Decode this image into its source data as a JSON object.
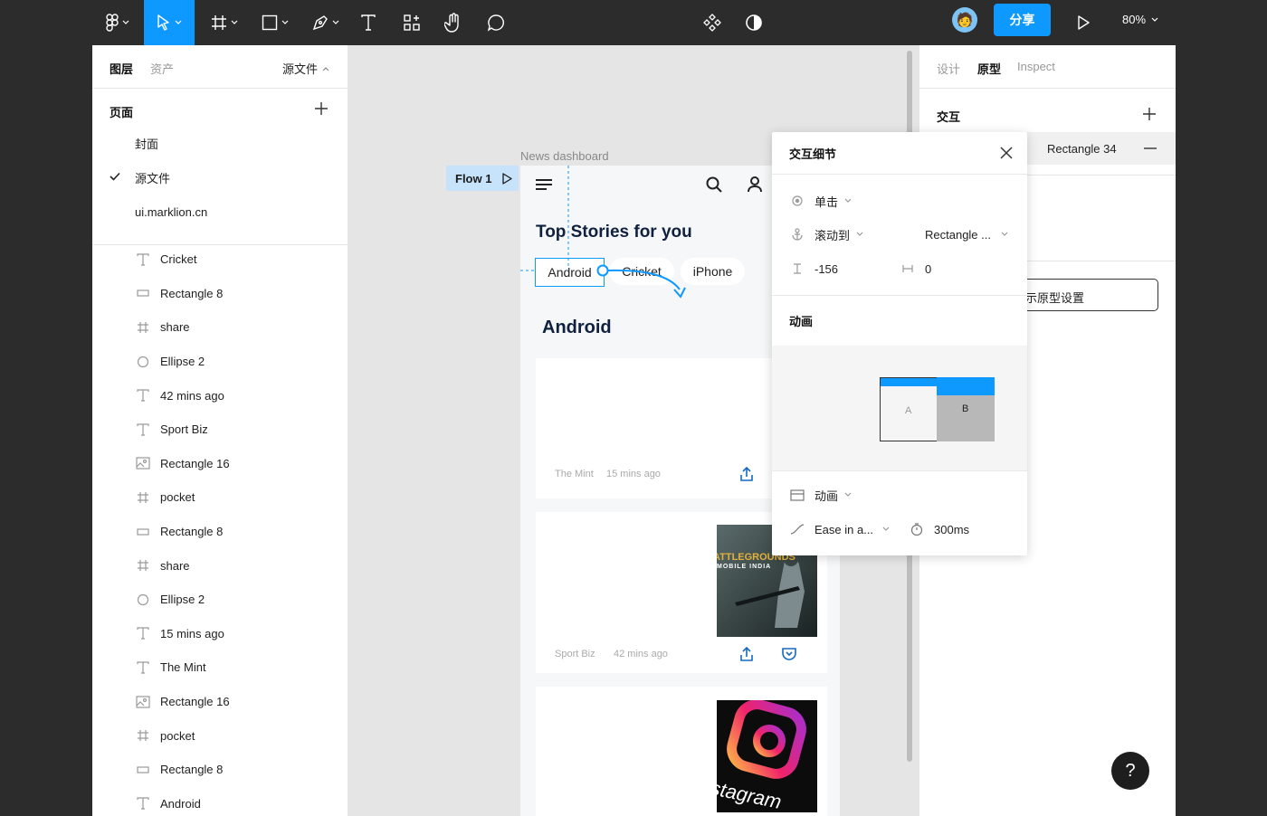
{
  "toolbar": {
    "share_label": "分享",
    "zoom_label": "80%"
  },
  "left_panel": {
    "tabs": {
      "layers": "图层",
      "assets": "资产"
    },
    "page_dropdown": "源文件",
    "pages_title": "页面",
    "pages": [
      {
        "label": "封面",
        "selected": false
      },
      {
        "label": "源文件",
        "selected": true
      },
      {
        "label": "ui.marklion.cn",
        "selected": false
      }
    ],
    "layers": [
      {
        "label": "Cricket",
        "icon": "text-icon"
      },
      {
        "label": "Rectangle 8",
        "icon": "rectangle-icon"
      },
      {
        "label": "share",
        "icon": "frame-icon"
      },
      {
        "label": "Ellipse 2",
        "icon": "ellipse-icon"
      },
      {
        "label": "42 mins ago",
        "icon": "text-icon"
      },
      {
        "label": "Sport Biz",
        "icon": "text-icon"
      },
      {
        "label": "Rectangle 16",
        "icon": "image-icon"
      },
      {
        "label": "pocket",
        "icon": "frame-icon"
      },
      {
        "label": "Rectangle 8",
        "icon": "rectangle-icon"
      },
      {
        "label": "share",
        "icon": "frame-icon"
      },
      {
        "label": "Ellipse 2",
        "icon": "ellipse-icon"
      },
      {
        "label": "15 mins ago",
        "icon": "text-icon"
      },
      {
        "label": "The Mint",
        "icon": "text-icon"
      },
      {
        "label": "Rectangle 16",
        "icon": "image-icon"
      },
      {
        "label": "pocket",
        "icon": "frame-icon"
      },
      {
        "label": "Rectangle 8",
        "icon": "rectangle-icon"
      },
      {
        "label": "Android",
        "icon": "text-icon"
      }
    ]
  },
  "canvas": {
    "frame_label": "News dashboard",
    "flow_label": "Flow 1",
    "frame": {
      "heading": "Top Stories for you",
      "chips": [
        "Android",
        "Cricket",
        "iPhone"
      ],
      "section_title": "Android",
      "cards": [
        {
          "source": "The Mint",
          "time": "15 mins ago"
        },
        {
          "source": "Sport Biz",
          "time": "42 mins ago",
          "thumb_line1": "ATTLEGROUNDS",
          "thumb_line2": "MOBILE INDIA"
        },
        {
          "thumb_text": "stagram"
        }
      ]
    }
  },
  "right_panel": {
    "tabs": {
      "design": "设计",
      "prototype": "原型",
      "inspect": "Inspect"
    },
    "interactions_title": "交互",
    "interaction_target": "Rectangle 34",
    "settings_button": "示原型设置"
  },
  "popover": {
    "title": "交互细节",
    "trigger": "单击",
    "action": "滚动到",
    "destination": "Rectangle ...",
    "offset_y": "-156",
    "offset_x": "0",
    "animation_title": "动画",
    "preview_a": "A",
    "preview_b": "B",
    "animation_type": "动画",
    "easing": "Ease in a...",
    "duration": "300ms"
  },
  "help_label": "?"
}
